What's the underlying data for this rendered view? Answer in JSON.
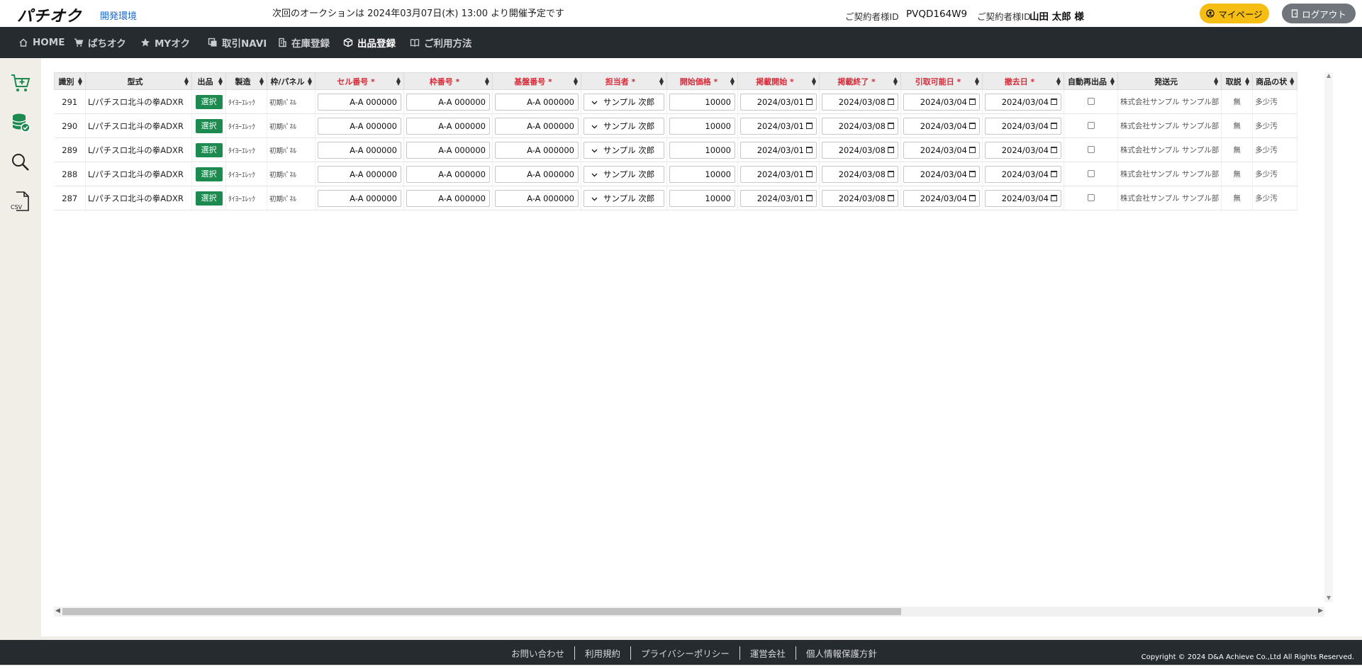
{
  "header": {
    "logo": "パチオク",
    "env_label": "開発環境",
    "notice": "次回のオークションは 2024年03月07日(木) 13:00 より開催予定です",
    "contract_label": "ご契約者様ID",
    "contract_id": "PVQD164W9",
    "user_label": "ご契約者様ID",
    "user_name": "山田 太郎 様",
    "mypage_label": "マイページ",
    "logout_label": "ログアウト",
    "colors": {
      "mypage": "#f6bd12",
      "logout": "#6f757b",
      "nav_bg": "#262b30"
    }
  },
  "nav": [
    {
      "label": "HOME",
      "icon": "home-icon"
    },
    {
      "label": "ぱちオク",
      "icon": "cart-icon"
    },
    {
      "label": "MYオク",
      "icon": "star-icon"
    },
    {
      "label": "取引NAVI",
      "icon": "copy-icon"
    },
    {
      "label": "在庫登録",
      "icon": "building-icon"
    },
    {
      "label": "出品登録",
      "icon": "box-icon"
    },
    {
      "label": "ご利用方法",
      "icon": "book-icon"
    }
  ],
  "sidebar": [
    "cart-add-icon",
    "database-check-icon",
    "search-icon",
    "csv-file-icon"
  ],
  "table": {
    "columns": [
      {
        "label": "識別",
        "required": false
      },
      {
        "label": "型式",
        "required": false
      },
      {
        "label": "出品",
        "required": false
      },
      {
        "label": "製造",
        "required": false
      },
      {
        "label": "枠/パネル",
        "required": false
      },
      {
        "label": "セル番号 *",
        "required": true
      },
      {
        "label": "枠番号 *",
        "required": true
      },
      {
        "label": "基盤番号 *",
        "required": true
      },
      {
        "label": "担当者 *",
        "required": true
      },
      {
        "label": "開始価格 *",
        "required": true
      },
      {
        "label": "掲載開始 *",
        "required": true
      },
      {
        "label": "掲載終了 *",
        "required": true
      },
      {
        "label": "引取可能日 *",
        "required": true
      },
      {
        "label": "撤去日 *",
        "required": true
      },
      {
        "label": "自動再出品",
        "required": false
      },
      {
        "label": "発送元",
        "required": false
      },
      {
        "label": "取説",
        "required": false
      },
      {
        "label": "商品の状",
        "required": false
      }
    ],
    "select_label": "選択",
    "rows": [
      {
        "id": "291",
        "model": "L/パチスロ北斗の拳ADXR",
        "maker": "ﾀｲﾖｰｴﾚｯｸ",
        "panel": "初期ﾊﾟﾈﾙ",
        "cell": "A-A 000000",
        "frame": "A-A 000000",
        "board": "A-A 000000",
        "staff": "サンプル 次郎",
        "price": "10000",
        "start": "2024/03/01",
        "end": "2024/03/08",
        "pickup": "2024/03/04",
        "removal": "2024/03/04",
        "shipper": "株式会社サンプル サンプル部",
        "manual": "無",
        "condition": "多少汚"
      },
      {
        "id": "290",
        "model": "L/パチスロ北斗の拳ADXR",
        "maker": "ﾀｲﾖｰｴﾚｯｸ",
        "panel": "初期ﾊﾟﾈﾙ",
        "cell": "A-A 000000",
        "frame": "A-A 000000",
        "board": "A-A 000000",
        "staff": "サンプル 次郎",
        "price": "10000",
        "start": "2024/03/01",
        "end": "2024/03/08",
        "pickup": "2024/03/04",
        "removal": "2024/03/04",
        "shipper": "株式会社サンプル サンプル部",
        "manual": "無",
        "condition": "多少汚"
      },
      {
        "id": "289",
        "model": "L/パチスロ北斗の拳ADXR",
        "maker": "ﾀｲﾖｰｴﾚｯｸ",
        "panel": "初期ﾊﾟﾈﾙ",
        "cell": "A-A 000000",
        "frame": "A-A 000000",
        "board": "A-A 000000",
        "staff": "サンプル 次郎",
        "price": "10000",
        "start": "2024/03/01",
        "end": "2024/03/08",
        "pickup": "2024/03/04",
        "removal": "2024/03/04",
        "shipper": "株式会社サンプル サンプル部",
        "manual": "無",
        "condition": "多少汚"
      },
      {
        "id": "288",
        "model": "L/パチスロ北斗の拳ADXR",
        "maker": "ﾀｲﾖｰｴﾚｯｸ",
        "panel": "初期ﾊﾟﾈﾙ",
        "cell": "A-A 000000",
        "frame": "A-A 000000",
        "board": "A-A 000000",
        "staff": "サンプル 次郎",
        "price": "10000",
        "start": "2024/03/01",
        "end": "2024/03/08",
        "pickup": "2024/03/04",
        "removal": "2024/03/04",
        "shipper": "株式会社サンプル サンプル部",
        "manual": "無",
        "condition": "多少汚"
      },
      {
        "id": "287",
        "model": "L/パチスロ北斗の拳ADXR",
        "maker": "ﾀｲﾖｰｴﾚｯｸ",
        "panel": "初期ﾊﾟﾈﾙ",
        "cell": "A-A 000000",
        "frame": "A-A 000000",
        "board": "A-A 000000",
        "staff": "サンプル 次郎",
        "price": "10000",
        "start": "2024/03/01",
        "end": "2024/03/08",
        "pickup": "2024/03/04",
        "removal": "2024/03/04",
        "shipper": "株式会社サンプル サンプル部",
        "manual": "無",
        "condition": "多少汚"
      }
    ]
  },
  "footer": {
    "links": [
      "お問い合わせ",
      "利用規約",
      "プライバシーポリシー",
      "運営会社",
      "個人情報保護方針"
    ],
    "copyright": "Copyright © 2024 D&A Achieve Co.,Ltd All Rights Reserved."
  }
}
